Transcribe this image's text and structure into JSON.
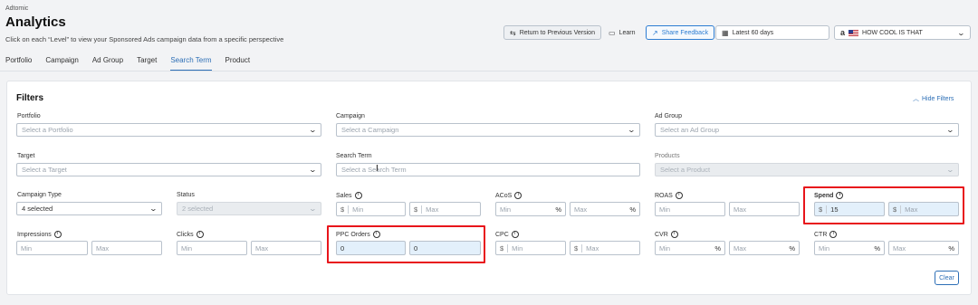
{
  "brand": "Adtomic",
  "title": "Analytics",
  "subtitle": "Click on each “Level” to view your Sponsored Ads campaign data from a specific perspective",
  "header": {
    "return_label": "Return to Previous Version",
    "learn_label": "Learn",
    "feedback_label": "Share Feedback",
    "date_label": "Latest 60 days",
    "account_label": "HOW COOL IS THAT",
    "account_marketplace": "a"
  },
  "tabs": [
    "Portfolio",
    "Campaign",
    "Ad Group",
    "Target",
    "Search Term",
    "Product"
  ],
  "active_tab": "Search Term",
  "filters": {
    "title": "Filters",
    "hide_label": "Hide Filters",
    "portfolio": {
      "label": "Portfolio",
      "placeholder": "Select a Portfolio"
    },
    "campaign": {
      "label": "Campaign",
      "placeholder": "Select a Campaign"
    },
    "ad_group": {
      "label": "Ad Group",
      "placeholder": "Select an Ad Group"
    },
    "target": {
      "label": "Target",
      "placeholder": "Select a Target"
    },
    "search_term": {
      "label": "Search Term",
      "placeholder": "Select a Search Term"
    },
    "products": {
      "label": "Products",
      "placeholder": "Select a Product"
    },
    "campaign_type": {
      "label": "Campaign Type",
      "value": "4 selected"
    },
    "status": {
      "label": "Status",
      "value": "2 selected"
    },
    "sales": {
      "label": "Sales",
      "prefix": "$",
      "min": "Min",
      "max": "Max"
    },
    "acos": {
      "label": "ACoS",
      "suffix": "%",
      "min": "Min",
      "max": "Max"
    },
    "roas": {
      "label": "ROAS",
      "min": "Min",
      "max": "Max"
    },
    "spend": {
      "label": "Spend",
      "prefix": "$",
      "min_value": "15",
      "max": "Max"
    },
    "impressions": {
      "label": "Impressions",
      "min": "Min",
      "max": "Max"
    },
    "clicks": {
      "label": "Clicks",
      "min": "Min",
      "max": "Max"
    },
    "ppc_orders": {
      "label": "PPC Orders",
      "min_value": "0",
      "max_value": "0"
    },
    "cpc": {
      "label": "CPC",
      "prefix": "$",
      "min": "Min",
      "max": "Max"
    },
    "cvr": {
      "label": "CVR",
      "suffix": "%",
      "min": "Min",
      "max": "Max"
    },
    "ctr": {
      "label": "CTR",
      "suffix": "%",
      "min": "Min",
      "max": "Max"
    },
    "clear_label": "Clear"
  },
  "colors": {
    "accent": "#2d6fb6",
    "highlight": "#e8151b",
    "filled": "#e3f0fb"
  }
}
